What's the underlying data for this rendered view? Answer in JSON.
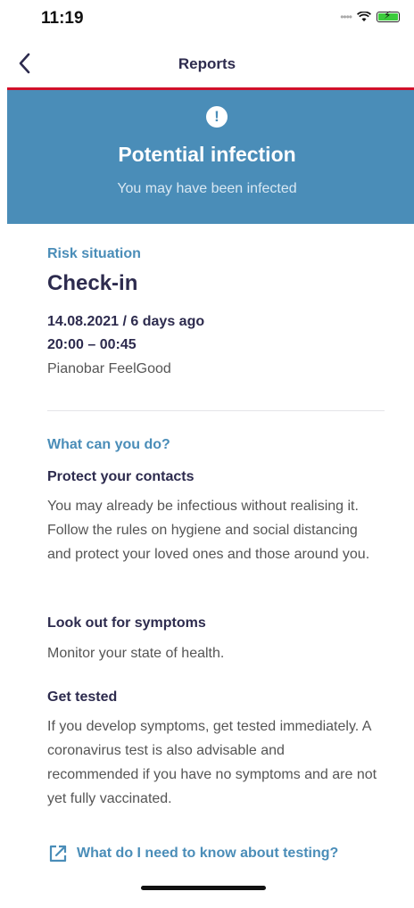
{
  "status_bar": {
    "time": "11:19",
    "battery_color": "#3ccb3c"
  },
  "nav": {
    "title": "Reports"
  },
  "hero": {
    "title": "Potential infection",
    "subtitle": "You may have been infected",
    "icon_glyph": "!",
    "background": "#4a8db8"
  },
  "risk": {
    "label": "Risk situation",
    "title": "Check-in",
    "date": "14.08.2021 / 6 days ago",
    "time_range": "20:00 – 00:45",
    "venue": "Pianobar FeelGood"
  },
  "actions": {
    "label": "What can you do?",
    "sections": [
      {
        "heading": "Protect your contacts",
        "text": "You may already be infectious without realising it. Follow the rules on hygiene and social distancing and protect your loved ones and those around you."
      },
      {
        "heading": "Look out for symptoms",
        "text": "Monitor your state of health."
      },
      {
        "heading": "Get tested",
        "text": "If you develop symptoms, get tested immediately. A coronavirus test is also advisable and recommended if you have no symptoms and are not yet fully vaccinated."
      }
    ],
    "link_text": "What do I need to know about testing?"
  },
  "colors": {
    "accent_red": "#d1102a",
    "accent_blue": "#4a8db8",
    "text_dark": "#2d2b4e"
  }
}
